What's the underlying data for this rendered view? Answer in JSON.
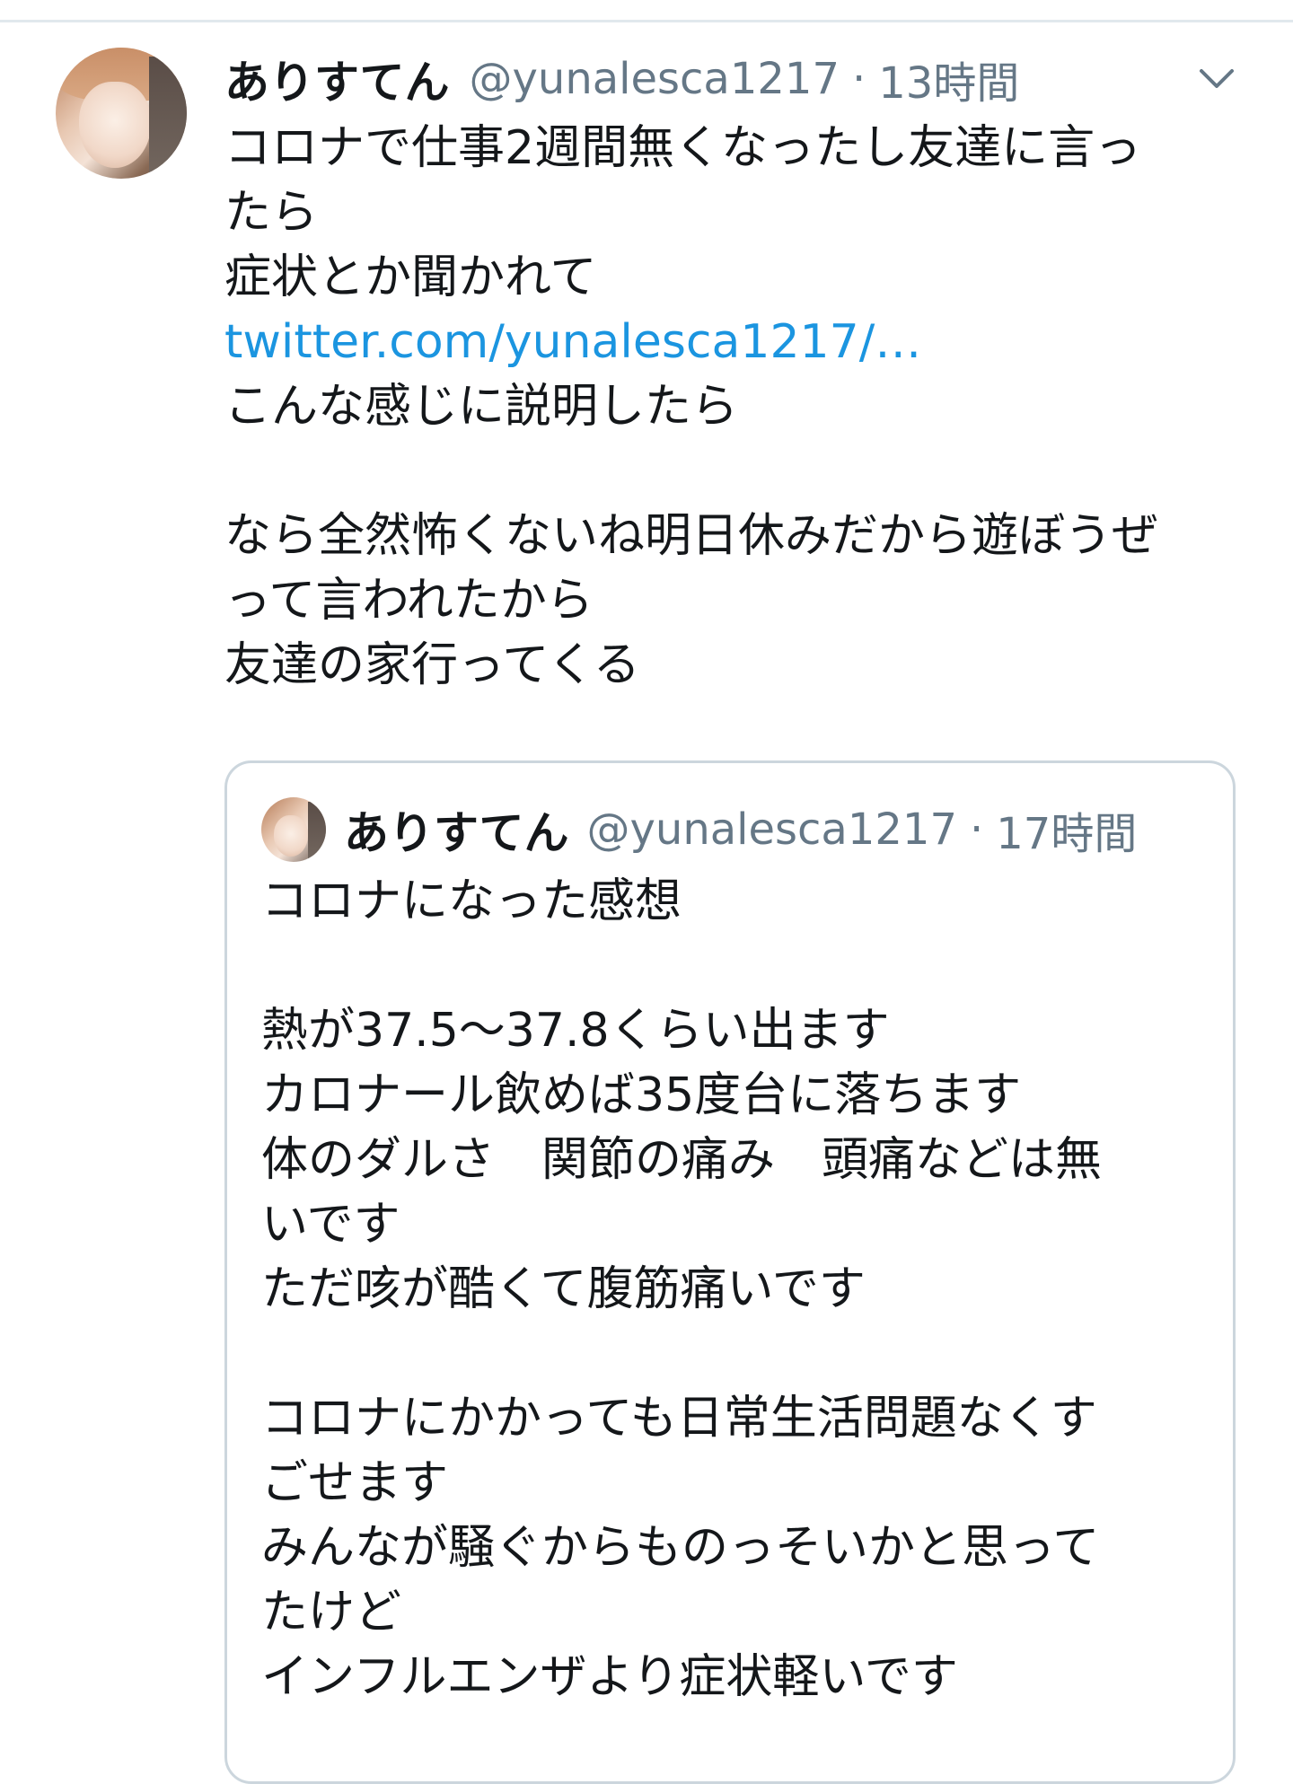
{
  "tweet": {
    "display_name": "ありすてん",
    "handle": "@yunalesca1217",
    "separator": "·",
    "time": "13時間",
    "lines": [
      "コロナで仕事2週間無くなったし友達に言っ",
      "たら",
      "症状とか聞かれて",
      "twitter.com/yunalesca1217/…",
      "こんな感じに説明したら",
      "",
      "なら全然怖くないね明日休みだから遊ぼうぜ",
      "って言われたから",
      "友達の家行ってくる"
    ]
  },
  "quoted_tweet": {
    "display_name": "ありすてん",
    "handle": "@yunalesca1217",
    "separator": "·",
    "time": "17時間",
    "lines": [
      "コロナになった感想",
      "",
      "熱が37.5〜37.8くらい出ます",
      "カロナール飲めば35度台に落ちます",
      "体のダルさ　関節の痛み　頭痛などは無",
      "いです",
      "ただ咳が酷くて腹筋痛いです",
      "",
      "コロナにかかっても日常生活問題なくす",
      "ごせます",
      "みんなが騒ぐからものっそいかと思って",
      "たけど",
      "インフルエンザより症状軽いです"
    ]
  },
  "icons": {
    "menu": "chevron-down-icon",
    "avatar": "profile-avatar"
  },
  "colors": {
    "text": "#14171a",
    "secondary": "#657786",
    "link": "#1b95e0",
    "border": "#ccd6dd"
  }
}
